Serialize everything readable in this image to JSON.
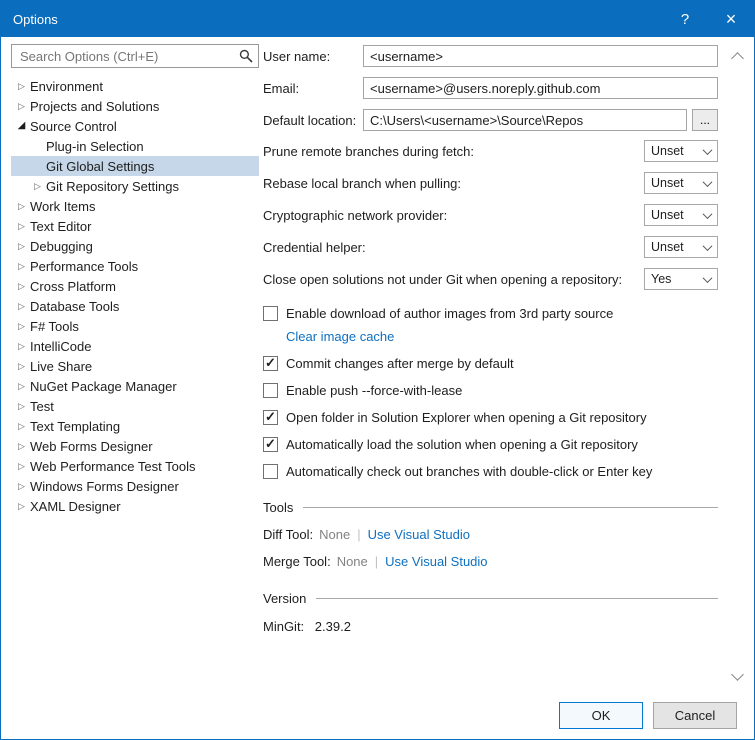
{
  "window": {
    "title": "Options",
    "help": "?",
    "close": "×"
  },
  "search": {
    "placeholder": "Search Options (Ctrl+E)"
  },
  "icons": {
    "check": "✓"
  },
  "tree": {
    "items": [
      {
        "label": "Environment",
        "glyph": "▷"
      },
      {
        "label": "Projects and Solutions",
        "glyph": "▷"
      },
      {
        "label": "Source Control",
        "glyph": "◢"
      },
      {
        "label": "Plug-in Selection",
        "glyph": ""
      },
      {
        "label": "Git Global Settings",
        "glyph": ""
      },
      {
        "label": "Git Repository Settings",
        "glyph": "▷"
      },
      {
        "label": "Work Items",
        "glyph": "▷"
      },
      {
        "label": "Text Editor",
        "glyph": "▷"
      },
      {
        "label": "Debugging",
        "glyph": "▷"
      },
      {
        "label": "Performance Tools",
        "glyph": "▷"
      },
      {
        "label": "Cross Platform",
        "glyph": "▷"
      },
      {
        "label": "Database Tools",
        "glyph": "▷"
      },
      {
        "label": "F# Tools",
        "glyph": "▷"
      },
      {
        "label": "IntelliCode",
        "glyph": "▷"
      },
      {
        "label": "Live Share",
        "glyph": "▷"
      },
      {
        "label": "NuGet Package Manager",
        "glyph": "▷"
      },
      {
        "label": "Test",
        "glyph": "▷"
      },
      {
        "label": "Text Templating",
        "glyph": "▷"
      },
      {
        "label": "Web Forms Designer",
        "glyph": "▷"
      },
      {
        "label": "Web Performance Test Tools",
        "glyph": "▷"
      },
      {
        "label": "Windows Forms Designer",
        "glyph": "▷"
      },
      {
        "label": "XAML Designer",
        "glyph": "▷"
      }
    ]
  },
  "fields": [
    {
      "label": "User name:",
      "value": "<username>"
    },
    {
      "label": "Email:",
      "value": "<username>@users.noreply.github.com"
    },
    {
      "label": "Default location:",
      "value": "C:\\Users\\<username>\\Source\\Repos",
      "browse": "..."
    }
  ],
  "dropdowns": [
    {
      "label": "Prune remote branches during fetch:",
      "value": "Unset"
    },
    {
      "label": "Rebase local branch when pulling:",
      "value": "Unset"
    },
    {
      "label": "Cryptographic network provider:",
      "value": "Unset"
    },
    {
      "label": "Credential helper:",
      "value": "Unset"
    },
    {
      "label": "Close open solutions not under Git when opening a repository:",
      "value": "Yes"
    }
  ],
  "checkboxes": [
    {
      "label": "Enable download of author images from 3rd party source",
      "checked": false
    },
    {
      "label": "Commit changes after merge by default",
      "checked": true
    },
    {
      "label": "Enable push --force-with-lease",
      "checked": false
    },
    {
      "label": "Open folder in Solution Explorer when opening a Git repository",
      "checked": true
    },
    {
      "label": "Automatically load the solution when opening a Git repository",
      "checked": true
    },
    {
      "label": "Automatically check out branches with double-click or Enter key",
      "checked": false
    }
  ],
  "links": {
    "clear_image_cache": "Clear image cache",
    "use_visual_studio": "Use Visual Studio"
  },
  "tools": {
    "title": "Tools",
    "separator": "|",
    "rows": [
      {
        "label": "Diff Tool:",
        "value": "None"
      },
      {
        "label": "Merge Tool:",
        "value": "None"
      }
    ]
  },
  "version": {
    "title": "Version",
    "label": "MinGit:",
    "value": "2.39.2"
  },
  "footer": {
    "ok": "OK",
    "cancel": "Cancel"
  },
  "colors": {
    "titlebar": "#0b6dbd",
    "selection": "#c6d7e9",
    "link": "#0e70c0",
    "accent": "#0078d4"
  }
}
